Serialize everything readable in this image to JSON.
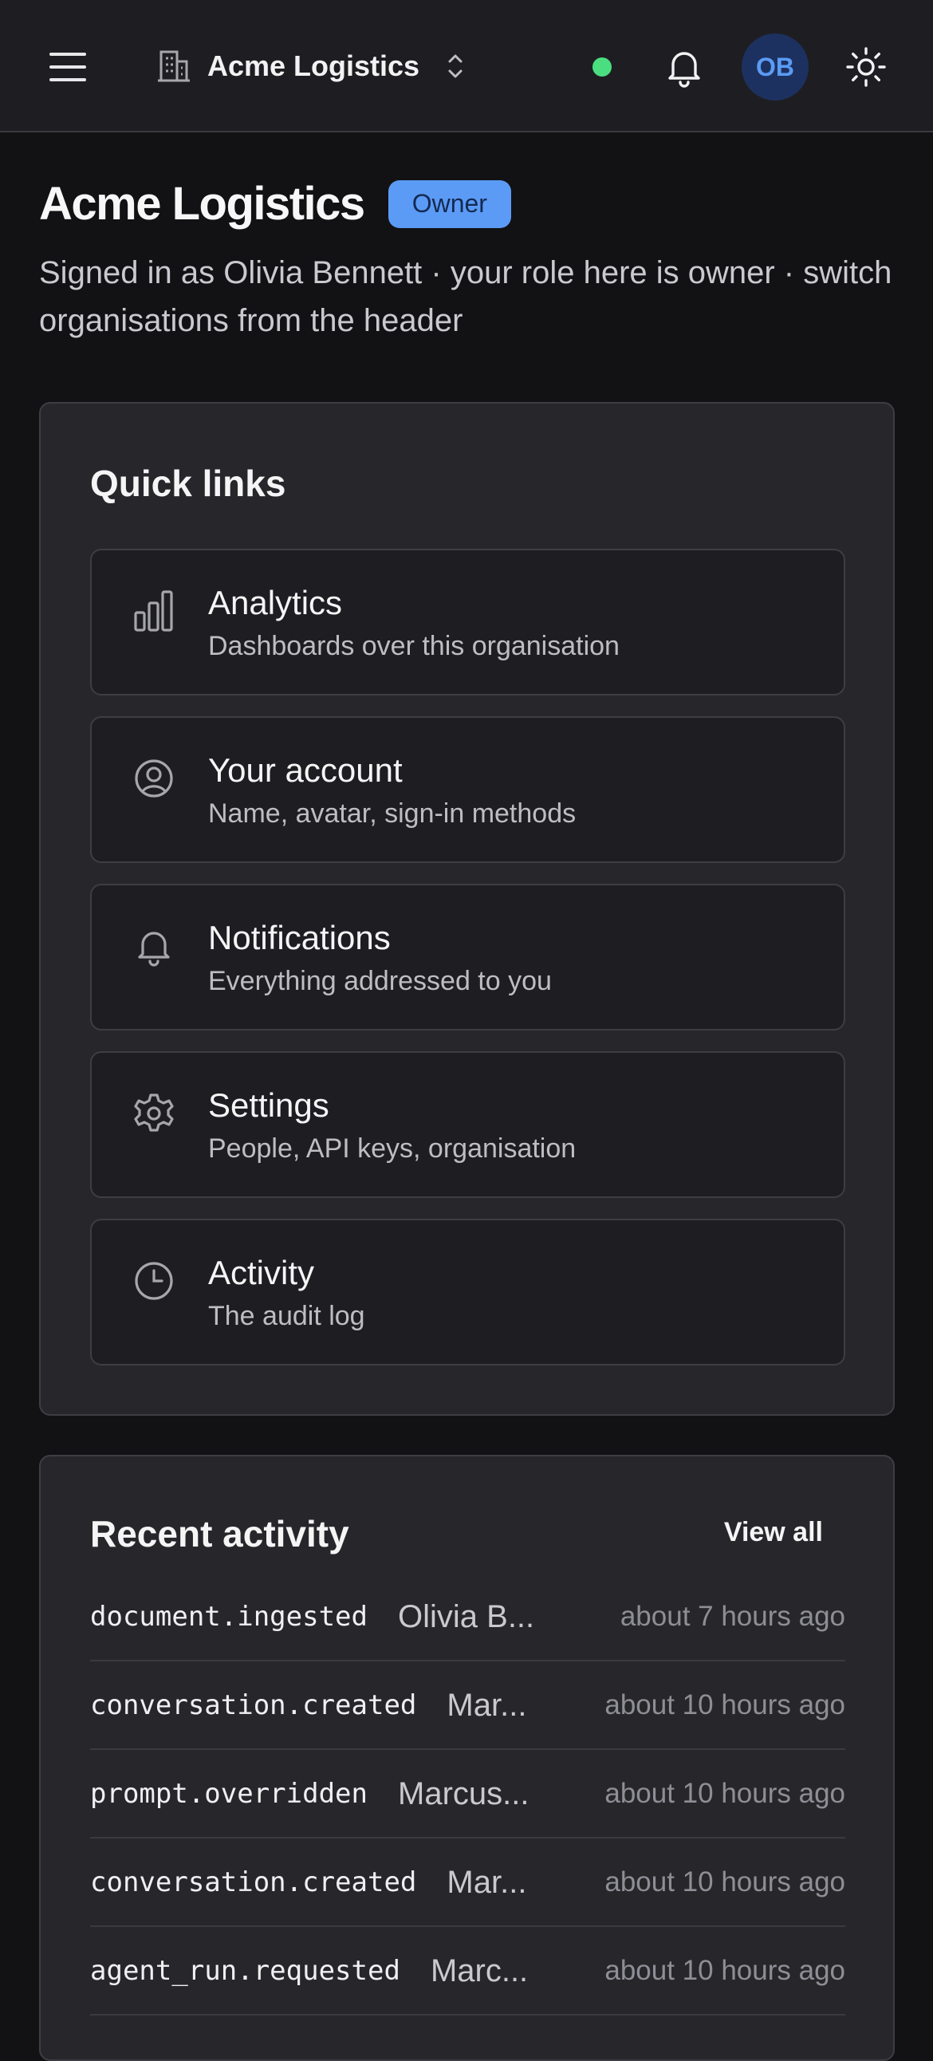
{
  "header": {
    "org_name": "Acme Logistics",
    "avatar_initials": "OB",
    "status_color": "#4ade80",
    "accent": "#5b9bf5"
  },
  "page": {
    "title": "Acme Logistics",
    "role_badge": "Owner",
    "subtitle": "Signed in as Olivia Bennett · your role here is owner · switch organisations from the header"
  },
  "quick_links": {
    "title": "Quick links",
    "items": [
      {
        "icon": "bar-chart-icon",
        "title": "Analytics",
        "desc": "Dashboards over this organisation"
      },
      {
        "icon": "user-circle-icon",
        "title": "Your account",
        "desc": "Name, avatar, sign-in methods"
      },
      {
        "icon": "bell-icon",
        "title": "Notifications",
        "desc": "Everything addressed to you"
      },
      {
        "icon": "gear-icon",
        "title": "Settings",
        "desc": "People, API keys, organisation"
      },
      {
        "icon": "clock-icon",
        "title": "Activity",
        "desc": "The audit log"
      }
    ]
  },
  "recent_activity": {
    "title": "Recent activity",
    "view_all": "View all",
    "rows": [
      {
        "event": "document.ingested",
        "actor": "Olivia B...",
        "time": "about 7 hours ago"
      },
      {
        "event": "conversation.created",
        "actor": "Mar...",
        "time": "about 10 hours ago"
      },
      {
        "event": "prompt.overridden",
        "actor": "Marcus...",
        "time": "about 10 hours ago"
      },
      {
        "event": "conversation.created",
        "actor": "Mar...",
        "time": "about 10 hours ago"
      },
      {
        "event": "agent_run.requested",
        "actor": "Marc...",
        "time": "about 10 hours ago"
      }
    ]
  }
}
